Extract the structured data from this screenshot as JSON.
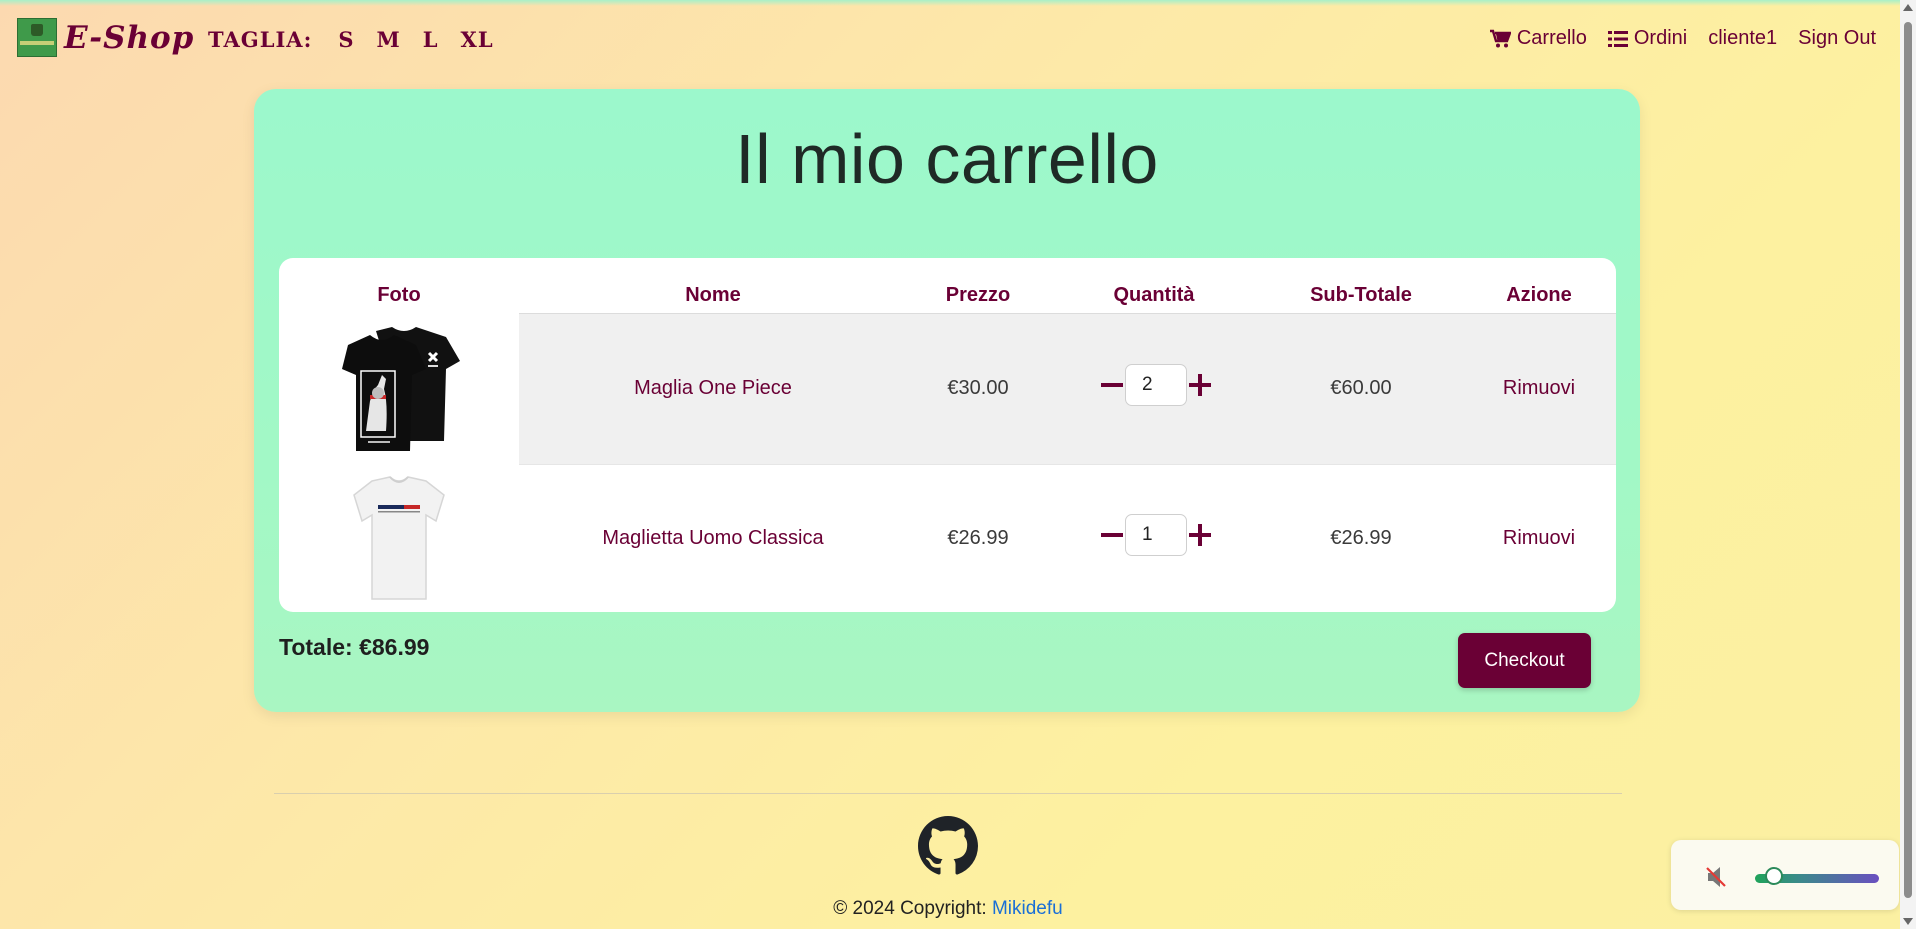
{
  "navbar": {
    "brand": "E-Shop",
    "sizes_label": "TAGLIA:",
    "sizes": [
      "S",
      "M",
      "L",
      "XL"
    ],
    "cart_label": "Carrello",
    "orders_label": "Ordini",
    "user_label": "cliente1",
    "signout_label": "Sign Out"
  },
  "cart": {
    "title": "Il mio carrello",
    "headers": {
      "photo": "Foto",
      "name": "Nome",
      "price": "Prezzo",
      "quantity": "Quantità",
      "subtotal": "Sub-Totale",
      "action": "Azione"
    },
    "items": [
      {
        "name": "Maglia One Piece",
        "price": "€30.00",
        "quantity": "2",
        "subtotal": "€60.00",
        "action": "Rimuovi",
        "image_icon": "black-tshirt-icon"
      },
      {
        "name": "Maglietta Uomo Classica",
        "price": "€26.99",
        "quantity": "1",
        "subtotal": "€26.99",
        "action": "Rimuovi",
        "image_icon": "white-tshirt-icon"
      }
    ],
    "total_label": "Totale: €86.99",
    "checkout_label": "Checkout"
  },
  "footer": {
    "copyright_prefix": "© 2024 Copyright: ",
    "copyright_link": "Mikidefu"
  },
  "audio": {
    "muted": true,
    "volume_fraction": 0.12
  },
  "colors": {
    "accent": "#6a0035",
    "card": "#9cf8cc",
    "link": "#1a6fd6"
  }
}
